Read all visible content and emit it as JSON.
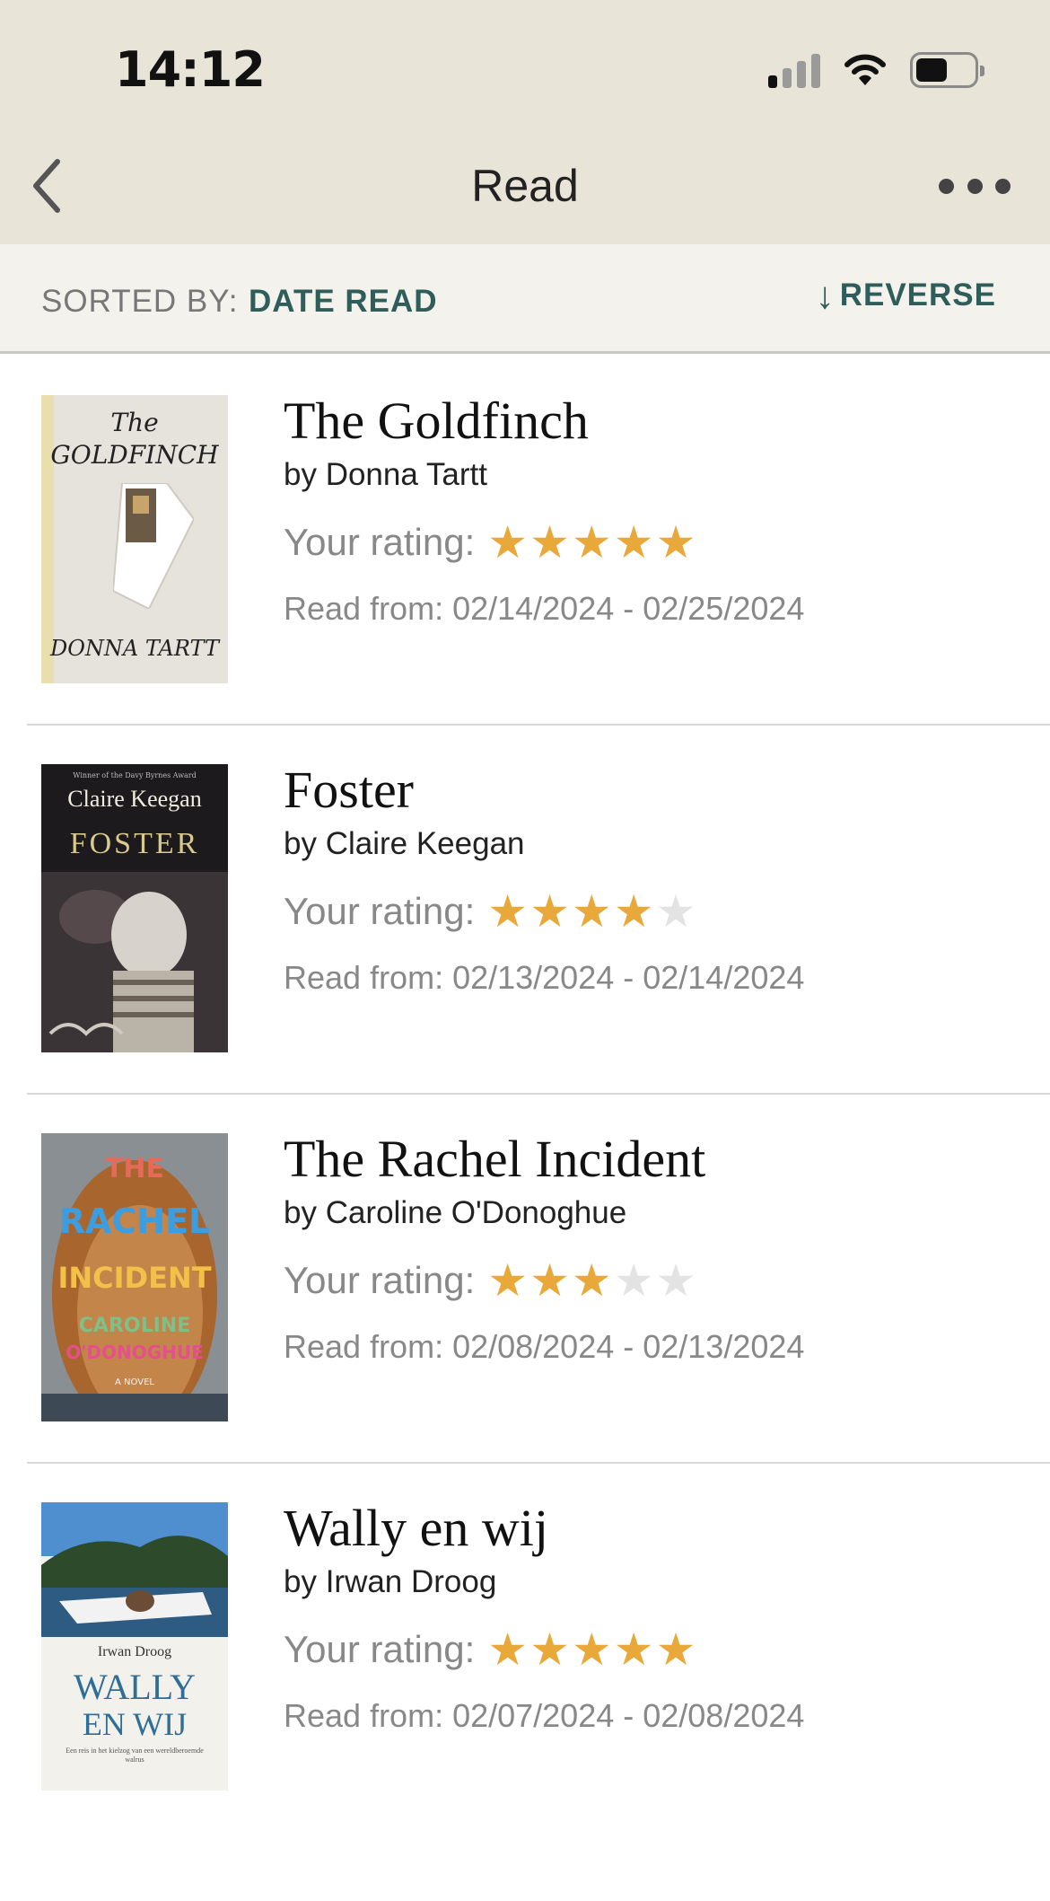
{
  "status_bar": {
    "time": "14:12",
    "battery_fraction": 0.55
  },
  "nav": {
    "title": "Read",
    "back_icon": "chevron-left-icon",
    "more_icon": "ellipsis-icon"
  },
  "sort": {
    "label": "SORTED BY:",
    "value": "DATE READ",
    "reverse_label": "REVERSE",
    "reverse_icon": "↓"
  },
  "colors": {
    "accent": "#2f5d5a",
    "star_filled": "#e8a93a",
    "star_empty": "#e3e3e3",
    "header_bg": "#e9e4d8"
  },
  "books": [
    {
      "title": "The Goldfinch",
      "author": "by Donna Tartt",
      "rating_label": "Your rating:",
      "rating": 5,
      "read_dates": "Read from: 02/14/2024 - 02/25/2024",
      "cover": {
        "line1": "The",
        "line2": "GOLDFINCH",
        "line3": "DONNA TARTT"
      }
    },
    {
      "title": "Foster",
      "author": "by Claire Keegan",
      "rating_label": "Your rating:",
      "rating": 4,
      "read_dates": "Read from: 02/13/2024 - 02/14/2024",
      "cover": {
        "line0": "Winner of the Davy Byrnes Award",
        "line1": "Claire Keegan",
        "line2": "FOSTER"
      }
    },
    {
      "title": "The Rachel Incident",
      "author": "by Caroline O'Donoghue",
      "rating_label": "Your rating:",
      "rating": 3,
      "read_dates": "Read from: 02/08/2024 - 02/13/2024",
      "cover": {
        "line1": "THE",
        "line2": "RACHEL",
        "line3": "INCIDENT",
        "line4": "CAROLINE",
        "line5": "O'DONOGHUE",
        "line6": "A NOVEL"
      }
    },
    {
      "title": "Wally en wij",
      "author": "by Irwan Droog",
      "rating_label": "Your rating:",
      "rating": 5,
      "read_dates": "Read from: 02/07/2024 - 02/08/2024",
      "cover": {
        "line1": "Irwan Droog",
        "line2": "WALLY",
        "line3": "EN WIJ",
        "line4": "Een reis in het kielzog van een wereldberoemde walrus"
      }
    }
  ]
}
